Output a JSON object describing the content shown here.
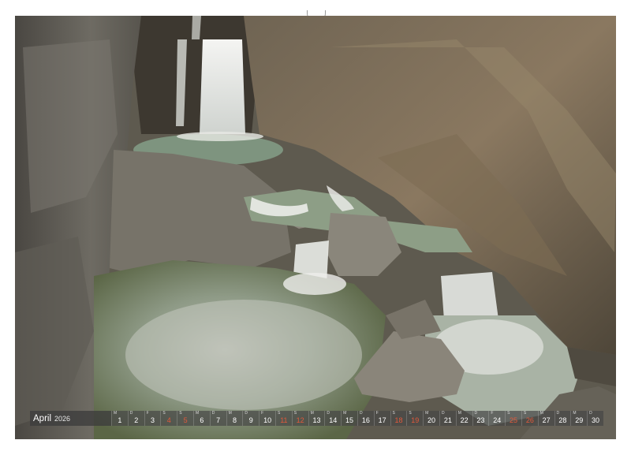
{
  "calendar": {
    "month": "April",
    "year": "2026",
    "weekday_letters": [
      "M",
      "D",
      "M",
      "D",
      "F",
      "S",
      "S"
    ],
    "first_weekday_index": 2,
    "days": [
      "1",
      "2",
      "3",
      "4",
      "5",
      "6",
      "7",
      "8",
      "9",
      "10",
      "11",
      "12",
      "13",
      "14",
      "15",
      "16",
      "17",
      "18",
      "19",
      "20",
      "21",
      "22",
      "23",
      "24",
      "25",
      "26",
      "27",
      "28",
      "29",
      "30"
    ],
    "weekend_days": [
      "4",
      "5",
      "11",
      "12",
      "18",
      "19",
      "25",
      "26"
    ],
    "colors": {
      "weekend": "#e2593b",
      "bar": "#464646",
      "text": "#ffffff"
    }
  },
  "photo": {
    "subject": "waterfall-in-rocky-gorge"
  }
}
